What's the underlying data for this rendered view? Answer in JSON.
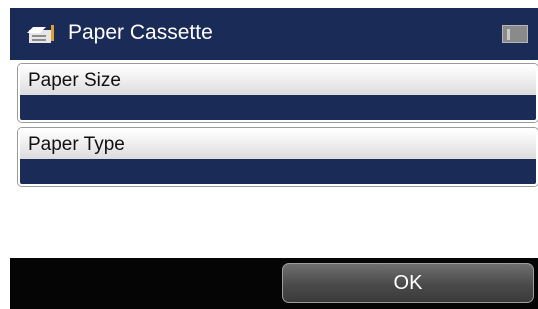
{
  "header": {
    "title": "Paper Cassette",
    "icon": "printer-cassette-icon"
  },
  "settings": [
    {
      "label": "Paper Size",
      "value": ""
    },
    {
      "label": "Paper Type",
      "value": ""
    }
  ],
  "footer": {
    "ok_label": "OK"
  },
  "colors": {
    "header_background": "#1b2b58",
    "value_background": "#1b2b58",
    "footer_background": "#050505",
    "button_background": "#4a4a4a"
  }
}
